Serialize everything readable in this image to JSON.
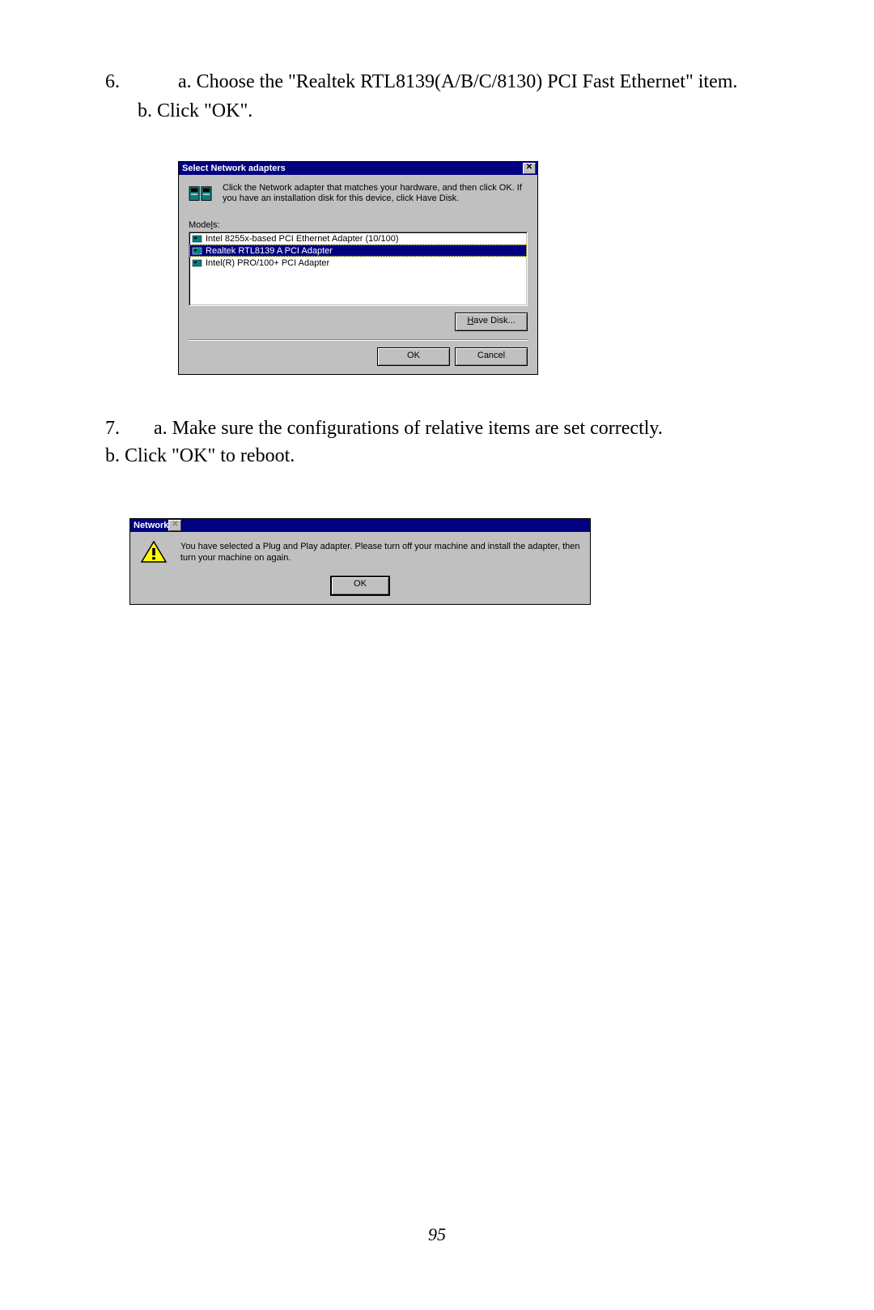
{
  "step6": {
    "number": "6.",
    "line_a": "a. Choose the \"Realtek RTL8139(A/B/C/8130) PCI Fast Ethernet\" item.",
    "line_b": "b. Click \"OK\"."
  },
  "dialog1": {
    "title": "Select Network adapters",
    "close_glyph": "✕",
    "info": "Click the Network adapter that matches your hardware, and then click OK. If you have an installation disk for this device, click Have Disk.",
    "models_label_pre": "Mode",
    "models_label_ul": "l",
    "models_label_post": "s:",
    "items": [
      "Intel 8255x-based PCI Ethernet Adapter (10/100)",
      "Realtek RTL8139 A PCI Adapter",
      "Intel(R) PRO/100+ PCI Adapter"
    ],
    "have_disk_ul": "H",
    "have_disk_rest": "ave Disk...",
    "ok": "OK",
    "cancel": "Cancel"
  },
  "step7": {
    "number": "7.",
    "line_a": "a. Make sure the configurations of relative items are set correctly.",
    "line_b": "b. Click \"OK\" to reboot."
  },
  "dialog2": {
    "title": "Network",
    "close_glyph": "✕",
    "message": "You have selected a Plug and Play adapter. Please turn off your machine and install the adapter, then turn your machine on again.",
    "ok": "OK"
  },
  "page_number": "95"
}
